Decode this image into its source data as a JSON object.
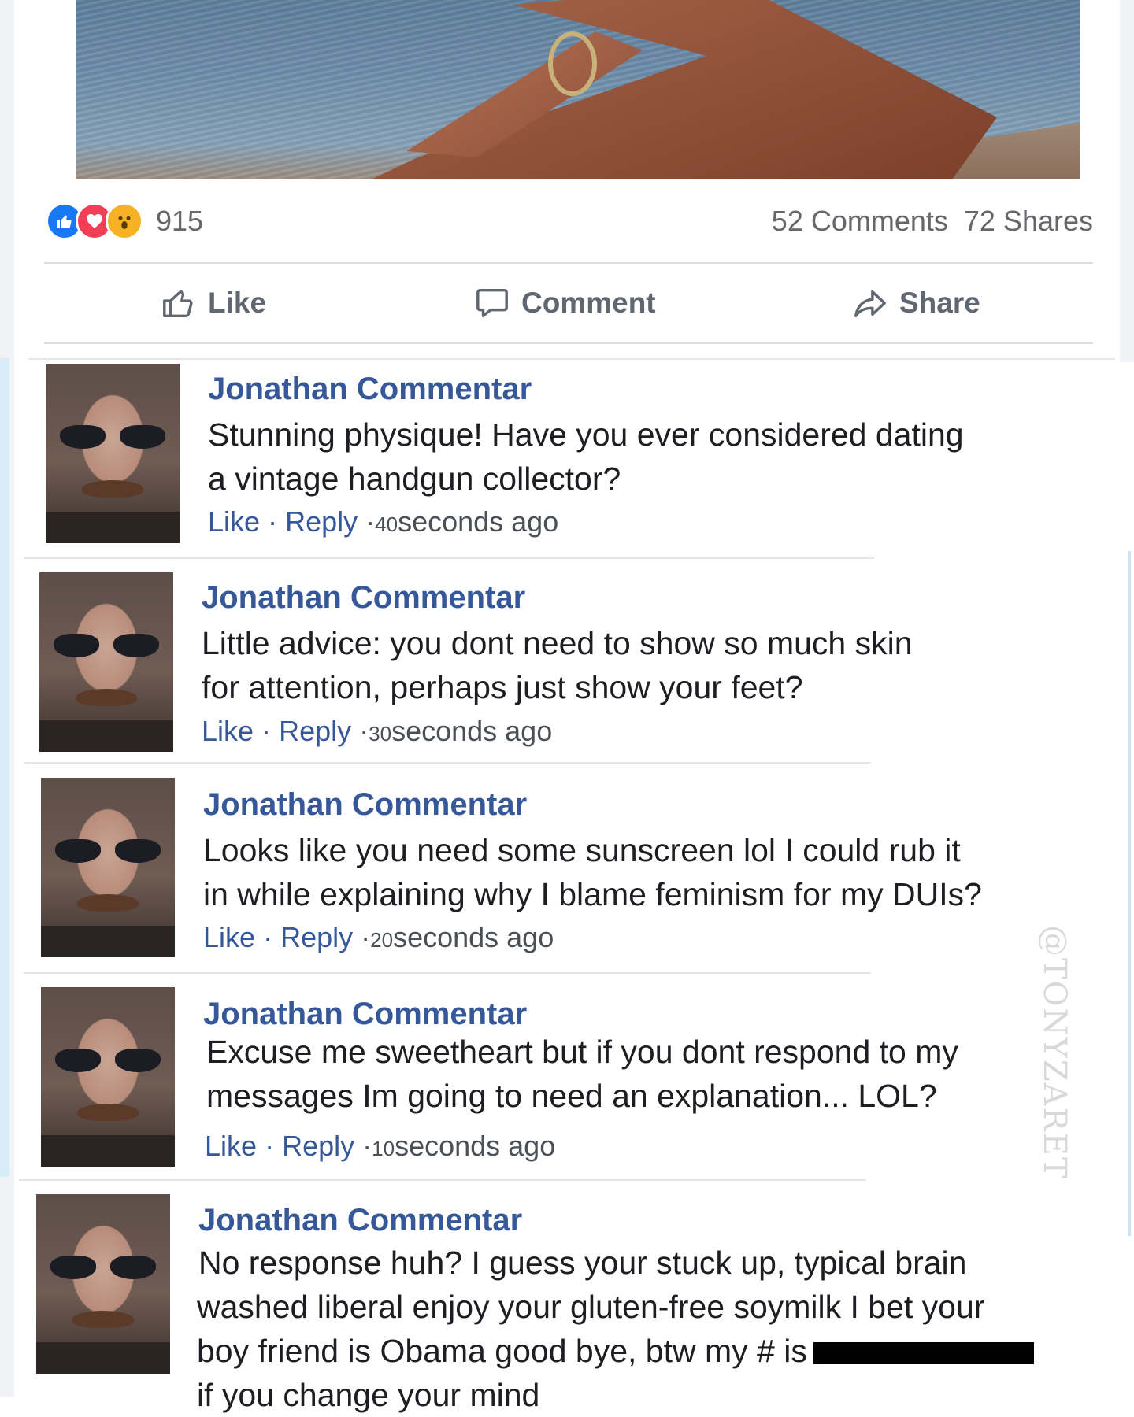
{
  "post": {
    "reaction_count": "915",
    "comments_count": "52 Comments",
    "shares_count": "72 Shares",
    "reaction_icons": [
      "like-icon",
      "love-icon",
      "wow-icon"
    ]
  },
  "actions": {
    "like": "Like",
    "comment": "Comment",
    "share": "Share"
  },
  "comments": [
    {
      "author": "Jonathan Commentar",
      "lines": [
        "Stunning physique! Have you ever considered dating",
        "a vintage handgun collector?"
      ],
      "like": "Like",
      "reply": "Reply",
      "time_num": "40",
      "time_text": "seconds ago"
    },
    {
      "author": "Jonathan Commentar",
      "lines": [
        "Little advice: you dont need to show so much skin",
        "for attention, perhaps just show your feet?"
      ],
      "like": "Like",
      "reply": "Reply",
      "time_num": "30",
      "time_text": "seconds ago"
    },
    {
      "author": "Jonathan Commentar",
      "lines": [
        "Looks like you need some sunscreen lol I could rub it",
        "in while explaining why I blame feminism for my DUIs?"
      ],
      "like": "Like",
      "reply": "Reply",
      "time_num": "20",
      "time_text": "seconds ago"
    },
    {
      "author": "Jonathan Commentar",
      "lines": [
        "Excuse me sweetheart but if you dont respond to my",
        "messages Im going to need an explanation... LOL?"
      ],
      "like": "Like",
      "reply": "Reply",
      "time_num": "10",
      "time_text": "seconds ago"
    },
    {
      "author": "Jonathan Commentar",
      "lines": [
        "No response huh? I guess your stuck up, typical brain",
        "washed liberal enjoy your gluten-free soymilk I bet your",
        "boy friend is Obama good bye, btw my # is",
        "if you change your mind"
      ]
    }
  ],
  "watermark": "@TONYZARET",
  "colors": {
    "link_blue": "#365899",
    "like_blue": "#1877f2",
    "love_red": "#f33e58",
    "wow_yellow": "#f7b125",
    "muted_gray": "#65676b"
  }
}
